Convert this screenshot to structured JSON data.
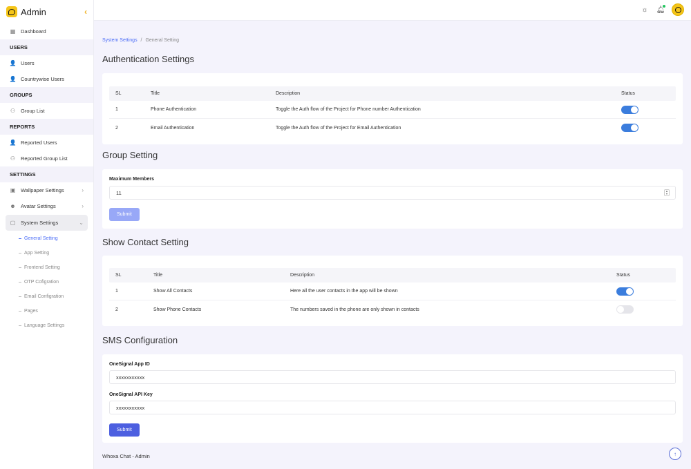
{
  "brand": {
    "name": "Admin"
  },
  "sidebar": {
    "dashboard": "Dashboard",
    "sections": {
      "users": "USERS",
      "groups": "GROUPS",
      "reports": "REPORTS",
      "settings": "SETTINGS"
    },
    "users": [
      "Users",
      "Countrywise Users"
    ],
    "groups": [
      "Group List"
    ],
    "reports": [
      "Reported Users",
      "Reported Group List"
    ],
    "settings": [
      "Wallpaper Settings",
      "Avatar Settings",
      "System Settings"
    ],
    "system_sub": [
      "General Setting",
      "App Setting",
      "Frontend Setting",
      "OTP Cofigration",
      "Email Configration",
      "Pages",
      "Language Settings"
    ],
    "active_sub": "General Setting"
  },
  "breadcrumb": {
    "parent": "System Settings",
    "separator": "/",
    "current": "General Setting"
  },
  "auth": {
    "title": "Authentication Settings",
    "columns": [
      "SL",
      "Title",
      "Description",
      "Status"
    ],
    "rows": [
      {
        "sl": "1",
        "title": "Phone Authentication",
        "description": "Toggle the Auth flow of the Project for Phone number Authentication",
        "enabled": true
      },
      {
        "sl": "2",
        "title": "Email Authentication",
        "description": "Toggle the Auth flow of the Project for Email Authentication",
        "enabled": true
      }
    ]
  },
  "group": {
    "title": "Group Setting",
    "max_label": "Maximum Members",
    "max_value": "11",
    "submit": "Submit"
  },
  "contact": {
    "title": "Show Contact Setting",
    "columns": [
      "SL",
      "Title",
      "Description",
      "Status"
    ],
    "rows": [
      {
        "sl": "1",
        "title": "Show All Contacts",
        "description": "Here all the user contacts in the app will be shown",
        "enabled": true
      },
      {
        "sl": "2",
        "title": "Show Phone Contacts",
        "description": "The numbers saved in the phone are only shown in contacts",
        "enabled": false
      }
    ]
  },
  "sms": {
    "title": "SMS Configuration",
    "app_id_label": "OneSignal App ID",
    "app_id_value": "xxxxxxxxxxx",
    "api_key_label": "OneSignal API Key",
    "api_key_value": "xxxxxxxxxxx",
    "submit": "Submit"
  },
  "footer": {
    "text": "Whoxa Chat - Admin"
  }
}
